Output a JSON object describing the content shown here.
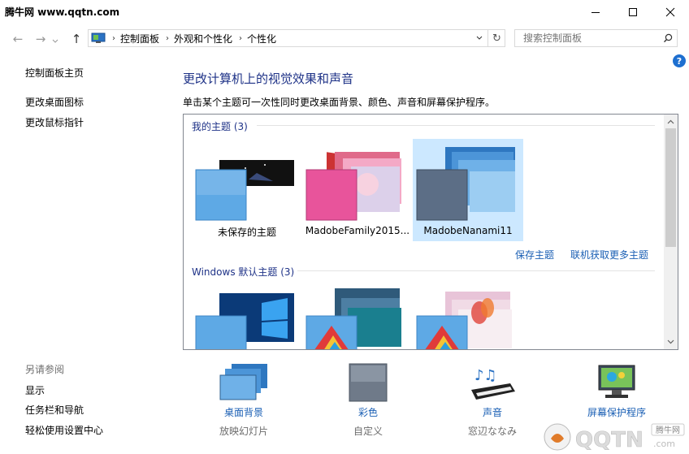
{
  "window": {
    "watermark": "腾牛网 www.qqtn.com"
  },
  "nav": {
    "back": "←",
    "forward": "→",
    "up": "↑",
    "refresh": "↻"
  },
  "breadcrumb": [
    "控制面板",
    "外观和个性化",
    "个性化"
  ],
  "search": {
    "placeholder": "搜索控制面板"
  },
  "help": "?",
  "sidebar": {
    "items": [
      "控制面板主页",
      "更改桌面图标",
      "更改鼠标指针"
    ],
    "see_also": {
      "title": "另请参阅",
      "items": [
        "显示",
        "任务栏和导航",
        "轻松使用设置中心"
      ]
    }
  },
  "main": {
    "title": "更改计算机上的视觉效果和声音",
    "description": "单击某个主题可一次性同时更改桌面背景、颜色、声音和屏幕保护程序。",
    "my_themes": {
      "label": "我的主题 (3)",
      "items": [
        {
          "name": "未保存的主题"
        },
        {
          "name": "MadobeFamily2015..."
        },
        {
          "name": "MadobeNanami11",
          "selected": true
        }
      ],
      "links": [
        "保存主题",
        "联机获取更多主题"
      ]
    },
    "windows_themes": {
      "label": "Windows 默认主题 (3)"
    }
  },
  "bottom": [
    {
      "label": "桌面背景",
      "sub": "放映幻灯片",
      "icon": "desktop-background-icon"
    },
    {
      "label": "彩色",
      "sub": "自定义",
      "icon": "color-swatch-icon"
    },
    {
      "label": "声音",
      "sub": "窓辺ななみ",
      "icon": "sound-piano-icon"
    },
    {
      "label": "屏幕保护程序",
      "sub": "",
      "icon": "screensaver-icon"
    }
  ],
  "watermark_bottom": {
    "text": "QQTN.com",
    "badge": "腾牛网"
  },
  "colors": {
    "accent": "#1e3287",
    "link": "#1a5fb4",
    "selection": "#cce8ff"
  }
}
